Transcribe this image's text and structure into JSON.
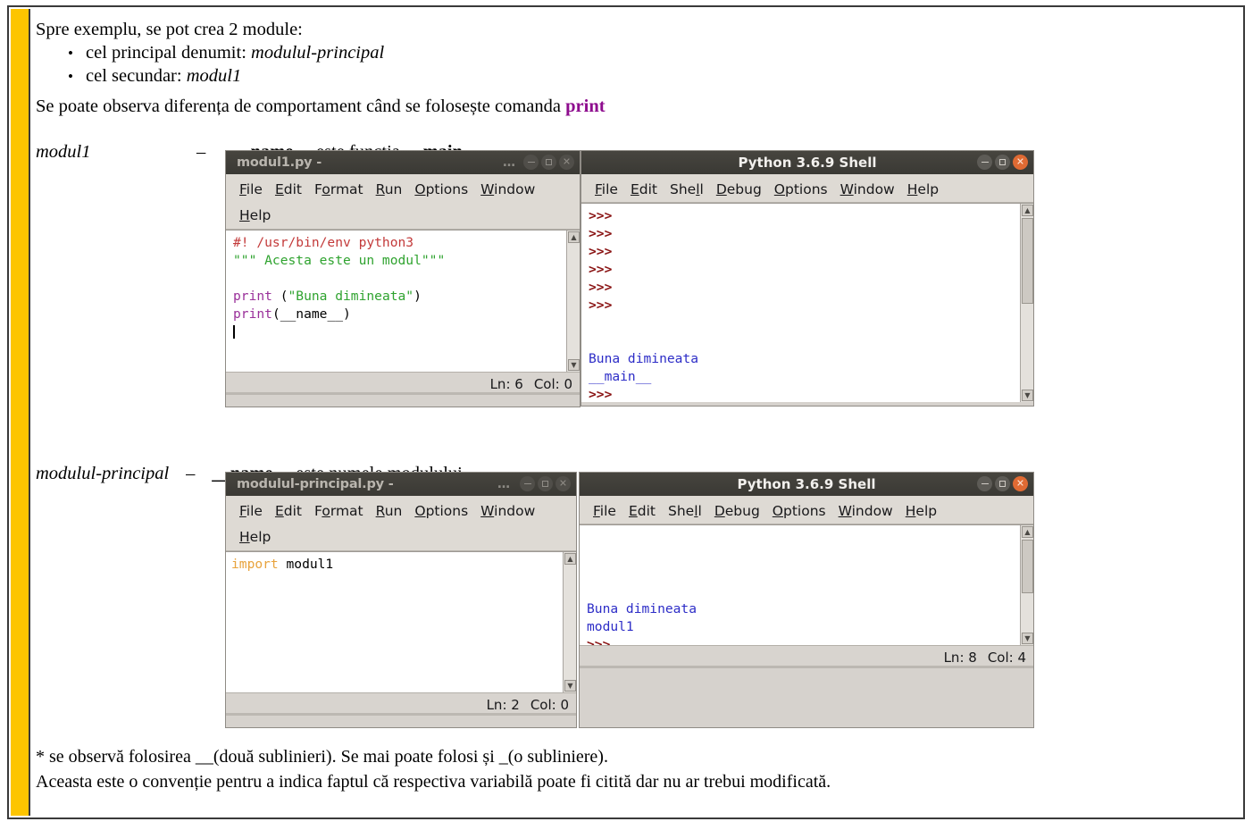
{
  "document": {
    "intro_line": "Spre exemplu, se pot crea 2 module:",
    "bullets": [
      {
        "marker": "•",
        "prefix": "cel principal denumit: ",
        "italic": "modulul-principal"
      },
      {
        "marker": "•",
        "prefix": "cel secundar: ",
        "italic": "modul1"
      }
    ],
    "observe_line_prefix": "Se poate observa diferența de comportament când se folosește comanda ",
    "observe_keyword": "print",
    "section1": {
      "label": "modul1",
      "dash": "–",
      "bold1": "__name__",
      "mid": " este funcția ",
      "bold2": "__main__"
    },
    "section2": {
      "label": "modulul-principal",
      "dash": "–",
      "bold1": "__name__",
      "mid": " este numele modulului"
    },
    "footnote": [
      "* se observă folosirea __(două sublinieri). Se mai poate folosi și _(o subliniere).",
      "Aceasta este o convenție pentru a indica faptul că respectiva variabilă poate fi citită dar nu ar trebui modificată."
    ],
    "accent_color": "#fdc500",
    "keyword_color": "#8e0c8e"
  },
  "editor1": {
    "title": "modul1.py -",
    "title_tail": "…",
    "menu": [
      "File",
      "Edit",
      "Format",
      "Run",
      "Options",
      "Window",
      "Help"
    ],
    "menu_mnemonics": [
      "F",
      "E",
      "o",
      "R",
      "O",
      "W",
      "H"
    ],
    "code_lines": [
      {
        "tokens": [
          {
            "text": "#! /usr/bin/env python3",
            "cls": "c-comment"
          }
        ]
      },
      {
        "tokens": [
          {
            "text": "\"\"\" Acesta este un modul\"\"\"",
            "cls": "c-string"
          }
        ]
      },
      {
        "tokens": [
          {
            "text": "",
            "cls": ""
          }
        ]
      },
      {
        "tokens": [
          {
            "text": "print",
            "cls": "c-kw"
          },
          {
            "text": " (",
            "cls": ""
          },
          {
            "text": "\"Buna dimineata\"",
            "cls": "c-string"
          },
          {
            "text": ")",
            "cls": ""
          }
        ]
      },
      {
        "tokens": [
          {
            "text": "print",
            "cls": "c-kw"
          },
          {
            "text": "(__name__)",
            "cls": ""
          }
        ]
      }
    ],
    "status_ln": "Ln: 6",
    "status_col": "Col: 0",
    "buttons": {
      "minimize": "minimize",
      "maximize": "maximize",
      "close": "close"
    }
  },
  "shell1": {
    "title": "Python 3.6.9 Shell",
    "menu": [
      "File",
      "Edit",
      "Shell",
      "Debug",
      "Options",
      "Window",
      "Help"
    ],
    "menu_mnemonics": [
      "F",
      "E",
      "l",
      "D",
      "O",
      "W",
      "H"
    ],
    "lines": [
      {
        "text": ">>>",
        "cls": "c-prompt"
      },
      {
        "text": ">>>",
        "cls": "c-prompt"
      },
      {
        "text": ">>>",
        "cls": "c-prompt"
      },
      {
        "text": ">>>",
        "cls": "c-prompt"
      },
      {
        "text": ">>>",
        "cls": "c-prompt"
      },
      {
        "text": ">>>",
        "cls": "c-prompt"
      },
      {
        "text": "",
        "cls": ""
      },
      {
        "text": "",
        "cls": ""
      },
      {
        "text": "Buna dimineata",
        "cls": "c-out"
      },
      {
        "text": "__main__",
        "cls": "c-out"
      },
      {
        "text": ">>>",
        "cls": "c-prompt"
      }
    ]
  },
  "editor2": {
    "title": "modulul-principal.py -",
    "title_tail": "…",
    "menu": [
      "File",
      "Edit",
      "Format",
      "Run",
      "Options",
      "Window",
      "Help"
    ],
    "menu_mnemonics": [
      "F",
      "E",
      "o",
      "R",
      "O",
      "W",
      "H"
    ],
    "code_lines": [
      {
        "tokens": [
          {
            "text": "import",
            "cls": "c-import"
          },
          {
            "text": " modul1",
            "cls": ""
          }
        ]
      }
    ],
    "status_ln": "Ln: 2",
    "status_col": "Col: 0"
  },
  "shell2": {
    "title": "Python 3.6.9 Shell",
    "menu": [
      "File",
      "Edit",
      "Shell",
      "Debug",
      "Options",
      "Window",
      "Help"
    ],
    "menu_mnemonics": [
      "F",
      "E",
      "l",
      "D",
      "O",
      "W",
      "H"
    ],
    "lines": [
      {
        "text": "",
        "cls": ""
      },
      {
        "text": "",
        "cls": ""
      },
      {
        "text": "",
        "cls": ""
      },
      {
        "text": "",
        "cls": ""
      },
      {
        "text": "Buna dimineata",
        "cls": "c-out"
      },
      {
        "text": "modul1",
        "cls": "c-out"
      },
      {
        "text": ">>>",
        "cls": "c-prompt"
      }
    ],
    "status_ln": "Ln: 8",
    "status_col": "Col: 4"
  }
}
